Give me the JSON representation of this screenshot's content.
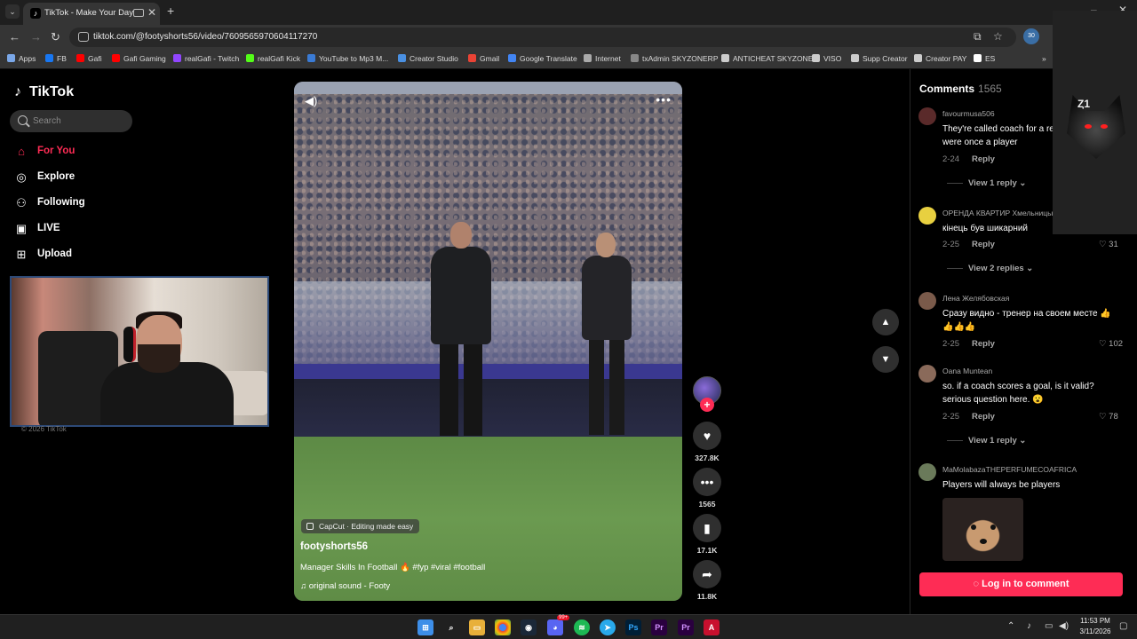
{
  "browser": {
    "tab_title": "TikTok - Make Your Day",
    "tab_favicon": "tiktok-note-icon",
    "url": "tiktok.com/@footyshorts56/video/7609565970604117270",
    "extension_badge": "30",
    "bookmarks": [
      {
        "label": "Apps",
        "icon": "apps-grid-icon",
        "color": "#7aa7e8"
      },
      {
        "label": "FB",
        "icon": "facebook-icon",
        "color": "#1877f2"
      },
      {
        "label": "Gafi",
        "icon": "youtube-icon",
        "color": "#ff0000"
      },
      {
        "label": "Gafi Gaming",
        "icon": "youtube-icon",
        "color": "#ff0000"
      },
      {
        "label": "realGafi - Twitch",
        "icon": "twitch-icon",
        "color": "#9146ff"
      },
      {
        "label": "realGafi Kick",
        "icon": "kick-icon",
        "color": "#53fc18"
      },
      {
        "label": "YouTube to Mp3 M...",
        "icon": "chevron-icon",
        "color": "#3a7bd5"
      },
      {
        "label": "Creator Studio",
        "icon": "studio-icon",
        "color": "#4a90e2"
      },
      {
        "label": "Gmail",
        "icon": "gmail-icon",
        "color": "#ea4335"
      },
      {
        "label": "Google Translate",
        "icon": "translate-icon",
        "color": "#4285f4"
      },
      {
        "label": "Internet",
        "icon": "wifi-icon",
        "color": "#aaaaaa"
      },
      {
        "label": "txAdmin SKYZONERP",
        "icon": "server-icon",
        "color": "#888888"
      },
      {
        "label": "ANTICHEAT SKYZONE",
        "icon": "shield-icon",
        "color": "#cccccc"
      },
      {
        "label": "VISO",
        "icon": "globe-icon",
        "color": "#cccccc"
      },
      {
        "label": "Supp Creator",
        "icon": "link-icon",
        "color": "#cccccc"
      },
      {
        "label": "Creator PAY",
        "icon": "globe-icon",
        "color": "#cccccc"
      },
      {
        "label": "ES",
        "icon": "es-icon",
        "color": "#ffffff"
      }
    ]
  },
  "sidebar": {
    "logo": "TikTok",
    "search_placeholder": "Search",
    "items": [
      {
        "label": "For You",
        "icon": "home-icon",
        "active": true
      },
      {
        "label": "Explore",
        "icon": "compass-icon",
        "active": false
      },
      {
        "label": "Following",
        "icon": "following-icon",
        "active": false
      },
      {
        "label": "LIVE",
        "icon": "live-icon",
        "active": false
      },
      {
        "label": "Upload",
        "icon": "upload-icon",
        "active": false
      }
    ],
    "copyright": "© 2026 TikTok"
  },
  "video": {
    "capcut_label": "CapCut · Editing made easy",
    "author": "footyshorts56",
    "description": "Manager Skills In Football 🔥 #fyp #viral #football",
    "sound": "original sound - Footy"
  },
  "actions": {
    "likes": "327.8K",
    "comments": "1565",
    "saves": "17.1K",
    "shares": "11.8K"
  },
  "comments": {
    "title": "Comments",
    "count": "1565",
    "items": [
      {
        "user": "favourmusa506",
        "text": "They're called coach for a reason they were once a player",
        "date": "2-24",
        "reply": "Reply",
        "likes": "",
        "view_replies": "View 1 reply",
        "avatar_color": "#5a2a2a"
      },
      {
        "user": "ОРЕНДА КВАРТИР Хмельницький",
        "text": "кінець був шикарний",
        "date": "2-25",
        "reply": "Reply",
        "likes": "31",
        "view_replies": "View 2 replies",
        "avatar_color": "#e8d040"
      },
      {
        "user": "Лена Желябовская",
        "text": "Сразу видно - тренер на своем месте 👍👍👍👍",
        "date": "2-25",
        "reply": "Reply",
        "likes": "102",
        "view_replies": "",
        "avatar_color": "#7a5a4a"
      },
      {
        "user": "Oana Muntean",
        "text": "so. if a coach scores a goal, is it valid? serious question here. 😮",
        "date": "2-25",
        "reply": "Reply",
        "likes": "78",
        "view_replies": "View 1 reply",
        "avatar_color": "#8a6a5a"
      },
      {
        "user": "MaMolabazaTHEPERFUMECOAFRICA",
        "text": "Players will always be players",
        "date": "",
        "reply": "",
        "likes": "",
        "view_replies": "",
        "avatar_color": "#6a7a5a"
      }
    ],
    "login_label": "Log in to comment"
  },
  "overlay": {
    "wolf_tag": "Ȥ1"
  },
  "taskbar": {
    "time": "11:53 PM",
    "date": "3/11/2026",
    "notification_badge": "99+"
  }
}
